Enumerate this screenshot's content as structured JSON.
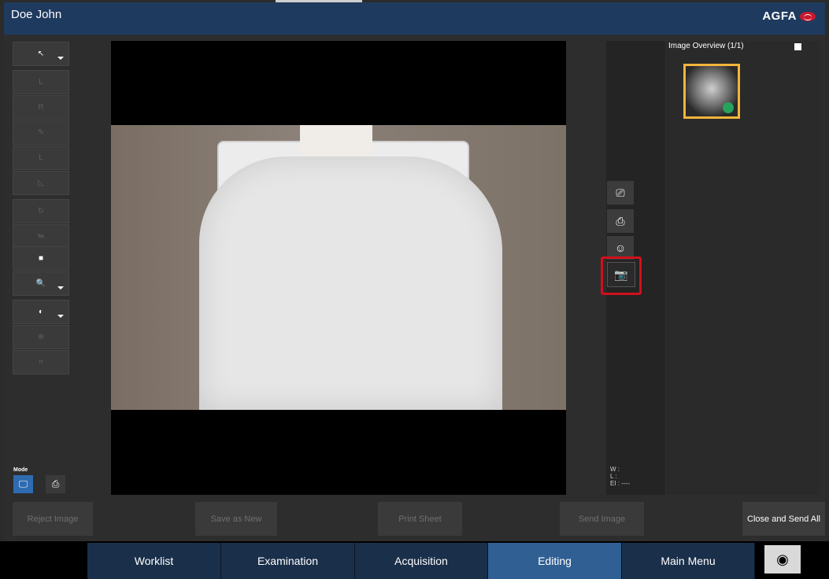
{
  "header": {
    "patient_name": "Doe John",
    "logo_text": "AGFA"
  },
  "toolbar": {
    "tools": [
      {
        "label": "↖",
        "icon": "pointer-icon"
      },
      {
        "label": "L",
        "icon": "left-marker-icon"
      },
      {
        "label": "R",
        "icon": "right-marker-icon"
      },
      {
        "label": "✎",
        "icon": "annotation-pen-icon"
      },
      {
        "label": "L",
        "icon": "text-label-icon"
      },
      {
        "label": "◺",
        "icon": "angle-icon"
      },
      {
        "label": "↻",
        "icon": "rotate-icon"
      },
      {
        "label": "⇋",
        "icon": "flip-icon"
      },
      {
        "label": "■",
        "icon": "invert-icon"
      },
      {
        "label": "🔍",
        "icon": "zoom-icon"
      },
      {
        "label": "◐",
        "icon": "contrast-icon"
      },
      {
        "label": "⊕",
        "icon": "pan-icon"
      },
      {
        "label": "⌗",
        "icon": "crop-icon"
      }
    ],
    "mode_label": "Mode"
  },
  "side_panel": {
    "buttons": [
      "monitor-icon",
      "printer-icon",
      "stitch-icon",
      "camera-icon"
    ],
    "wl_text": "W :\nL :\nEI : ----"
  },
  "overview": {
    "title": "Image Overview (1/1)"
  },
  "actions": {
    "reject": "Reject Image",
    "save_new": "Save as New",
    "print": "Print Sheet",
    "send": "Send Image",
    "close_send": "Close and Send All"
  },
  "nav": {
    "tabs": [
      "Worklist",
      "Examination",
      "Acquisition",
      "Editing",
      "Main Menu"
    ],
    "active": "Editing"
  }
}
